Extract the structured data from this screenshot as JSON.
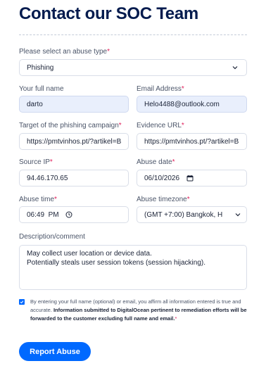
{
  "title": "Contact our SOC Team",
  "abuse_type": {
    "label": "Please select an abuse type",
    "required_mark": "*",
    "value": "Phishing"
  },
  "full_name": {
    "label": "Your full name",
    "value": "darto"
  },
  "email": {
    "label": "Email Address",
    "required_mark": "*",
    "value": "Helo4488@outlook.com"
  },
  "target": {
    "label": "Target of the phishing campaign",
    "required_mark": "*",
    "value": "https://pmtvinhos.pt/?artikel=B"
  },
  "evidence": {
    "label": "Evidence URL",
    "required_mark": "*",
    "value": "https://pmtvinhos.pt/?artikel=B"
  },
  "source_ip": {
    "label": "Source IP",
    "required_mark": "*",
    "value": "94.46.170.65"
  },
  "abuse_date": {
    "label": "Abuse date",
    "required_mark": "*",
    "value": "06/10/2026"
  },
  "abuse_time": {
    "label": "Abuse time",
    "required_mark": "*",
    "value": "06:49  PM"
  },
  "abuse_timezone": {
    "label": "Abuse timezone",
    "required_mark": "*",
    "value": "(GMT +7:00) Bangkok, H"
  },
  "description": {
    "label": "Description/comment",
    "line1": "May collect user location or device data.",
    "line2": "Potentially steals user session tokens (session hijacking)."
  },
  "consent": {
    "text_plain": "By entering your full name (optional) or email, you affirm all information entered is true and accurate.",
    "text_bold": "Information submitted to DigitalOcean pertinent to remediation efforts will be forwarded to the customer excluding full name and email.",
    "required_mark": "*",
    "checked": true
  },
  "submit_label": "Report Abuse",
  "colors": {
    "accent": "#0069ff",
    "title": "#031b4e",
    "required": "#e01e5a",
    "filled_bg": "#e9effc"
  }
}
